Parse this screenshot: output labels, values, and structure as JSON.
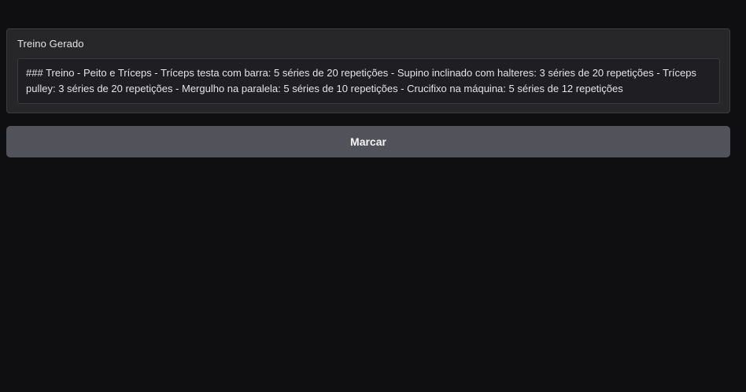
{
  "output": {
    "label": "Treino Gerado",
    "value": "### Treino - Peito e Tríceps - Tríceps testa com barra: 5 séries de 20 repetições - Supino inclinado com halteres: 3 séries de 20 repetições - Tríceps pulley: 3 séries de 20 repetições - Mergulho na paralela: 5 séries de 10 repetições - Crucifixo na máquina: 5 séries de 12 repetições"
  },
  "actions": {
    "submit_label": "Marcar"
  },
  "colors": {
    "background": "#0f0f11",
    "panel": "#27272a",
    "textbox": "#1f1f23",
    "button": "#52525b",
    "text": "#e4e4e7"
  }
}
